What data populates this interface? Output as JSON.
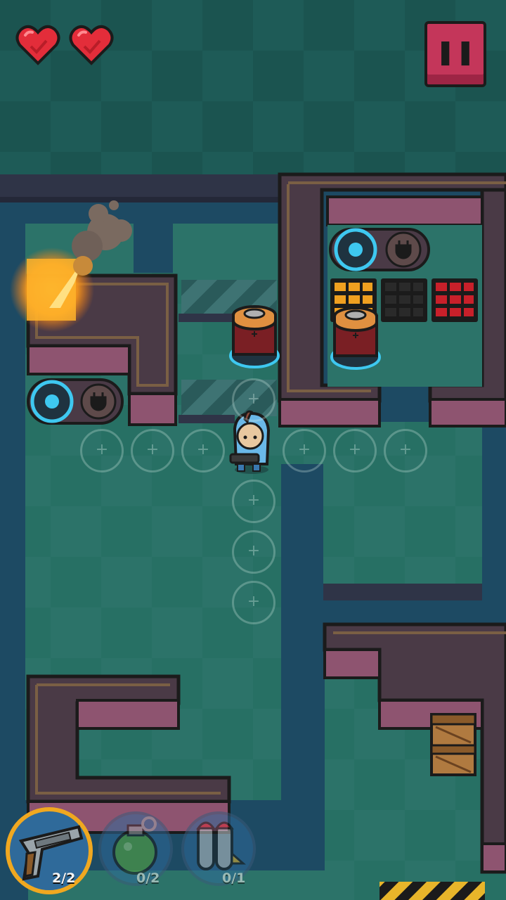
{
  "hud": {
    "lives": 2,
    "hearts": [
      "heart-full",
      "heart-full"
    ],
    "pause_icon": "pause-icon"
  },
  "inventory": [
    {
      "name": "pistol",
      "icon": "pistol-icon",
      "count": "2/2",
      "selected": true
    },
    {
      "name": "grenade",
      "icon": "grenade-icon",
      "count": "0/2",
      "selected": false
    },
    {
      "name": "rocket",
      "icon": "rocket-icon",
      "count": "0/1",
      "selected": false
    }
  ],
  "colors": {
    "water": "#1d4a63",
    "floor_light": "#2e7a70",
    "floor_dark": "#276a62",
    "wall_top": "#4a3a46",
    "wall_brick": "#8e5470",
    "accent_cyan": "#3ec8f0",
    "heart": "#e32d3a",
    "pause": "#c4365a",
    "fire": "#ff9a1a"
  }
}
